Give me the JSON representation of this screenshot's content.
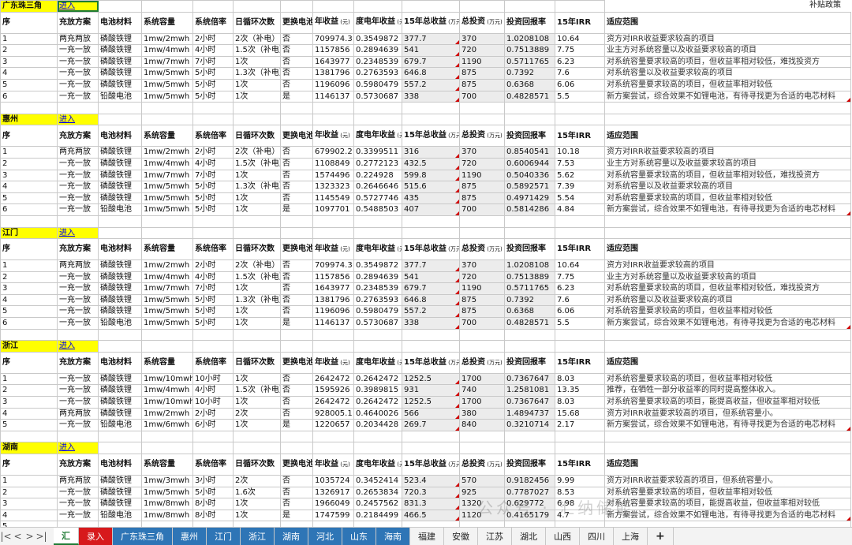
{
  "corner_note": "补贴政策",
  "watermark": "公众号 · 汇纳储能",
  "headers": [
    "序",
    "充放方案",
    "电池材料",
    "系统容量",
    "系统倍率",
    "日循环次数",
    "更换电池",
    "年收益",
    "度电年收益",
    "15年总收益",
    "总投资",
    "投资回报率",
    "15年IRR",
    "适应范围"
  ],
  "header_units": {
    "7": "(元)",
    "8": "(元)",
    "9": "(万元)",
    "10": "(万元)"
  },
  "regions": [
    {
      "name": "广东珠三角",
      "link": "进入",
      "rows": [
        [
          "1",
          "两充两放",
          "磷酸铁锂",
          "1mw/2mwh",
          "2小时",
          "2次（补电）",
          "否",
          "709974.3",
          "0.3549872",
          "377.7",
          "370",
          "1.0208108",
          "10.64",
          "资方对IRR收益要求较高的项目"
        ],
        [
          "2",
          "一充一放",
          "磷酸铁锂",
          "1mw/4mwh",
          "4小时",
          "1.5次（补电）",
          "否",
          "1157856",
          "0.2894639",
          "541",
          "720",
          "0.7513889",
          "7.75",
          "业主方对系统容量以及收益要求较高的项目"
        ],
        [
          "3",
          "一充一放",
          "磷酸铁锂",
          "1mw/7mwh",
          "7小时",
          "1次",
          "否",
          "1643977",
          "0.2348539",
          "679.7",
          "1190",
          "0.5711765",
          "6.23",
          "对系统容量要求较高的项目，但收益率相对较低，难找投资方"
        ],
        [
          "4",
          "一充一放",
          "磷酸铁锂",
          "1mw/5mwh",
          "5小时",
          "1.3次（补电）",
          "否",
          "1381796",
          "0.2763593",
          "646.8",
          "875",
          "0.7392",
          "7.6",
          "对系统容量以及收益要求较高的项目"
        ],
        [
          "5",
          "一充一放",
          "磷酸铁锂",
          "1mw/5mwh",
          "5小时",
          "1次",
          "否",
          "1196096",
          "0.5980479",
          "557.2",
          "875",
          "0.6368",
          "6.06",
          "对系统容量要求较高的项目，但收益率相对较低"
        ],
        [
          "6",
          "一充一放",
          "铅酸电池",
          "1mw/5mwh",
          "5小时",
          "1次",
          "是",
          "1146137",
          "0.5730687",
          "338",
          "700",
          "0.4828571",
          "5.5",
          "新方案尝试，综合效果不如锂电池，有待寻找更为合适的电芯材料"
        ]
      ]
    },
    {
      "name": "惠州",
      "link": "进入",
      "rows": [
        [
          "1",
          "两充两放",
          "磷酸铁锂",
          "1mw/2mwh",
          "2小时",
          "2次（补电）",
          "否",
          "679902.2",
          "0.3399511",
          "316",
          "370",
          "0.8540541",
          "10.18",
          "资方对IRR收益要求较高的项目"
        ],
        [
          "2",
          "一充一放",
          "磷酸铁锂",
          "1mw/4mwh",
          "4小时",
          "1.5次（补电）",
          "否",
          "1108849",
          "0.2772123",
          "432.5",
          "720",
          "0.6006944",
          "7.53",
          "业主方对系统容量以及收益要求较高的项目"
        ],
        [
          "3",
          "一充一放",
          "磷酸铁锂",
          "1mw/7mwh",
          "7小时",
          "1次",
          "否",
          "1574496",
          "0.224928",
          "599.8",
          "1190",
          "0.5040336",
          "5.62",
          "对系统容量要求较高的项目，但收益率相对较低，难找投资方"
        ],
        [
          "4",
          "一充一放",
          "磷酸铁锂",
          "1mw/5mwh",
          "5小时",
          "1.3次（补电）",
          "否",
          "1323323",
          "0.2646646",
          "515.6",
          "875",
          "0.5892571",
          "7.39",
          "对系统容量以及收益要求较高的项目"
        ],
        [
          "5",
          "一充一放",
          "磷酸铁锂",
          "1mw/5mwh",
          "5小时",
          "1次",
          "否",
          "1145549",
          "0.5727746",
          "435",
          "875",
          "0.4971429",
          "5.54",
          "对系统容量要求较高的项目，但收益率相对较低"
        ],
        [
          "6",
          "一充一放",
          "铅酸电池",
          "1mw/5mwh",
          "5小时",
          "1次",
          "是",
          "1097701",
          "0.5488503",
          "407",
          "700",
          "0.5814286",
          "4.84",
          "新方案尝试，综合效果不如锂电池，有待寻找更为合适的电芯材料"
        ]
      ]
    },
    {
      "name": "江门",
      "link": "进入",
      "rows": [
        [
          "1",
          "两充两放",
          "磷酸铁锂",
          "1mw/2mwh",
          "2小时",
          "2次（补电）",
          "否",
          "709974.3",
          "0.3549872",
          "377.7",
          "370",
          "1.0208108",
          "10.64",
          "资方对IRR收益要求较高的项目"
        ],
        [
          "2",
          "一充一放",
          "磷酸铁锂",
          "1mw/4mwh",
          "4小时",
          "1.5次（补电）",
          "否",
          "1157856",
          "0.2894639",
          "541",
          "720",
          "0.7513889",
          "7.75",
          "业主方对系统容量以及收益要求较高的项目"
        ],
        [
          "3",
          "一充一放",
          "磷酸铁锂",
          "1mw/7mwh",
          "7小时",
          "1次",
          "否",
          "1643977",
          "0.2348539",
          "679.7",
          "1190",
          "0.5711765",
          "6.23",
          "对系统容量要求较高的项目，但收益率相对较低，难找投资方"
        ],
        [
          "4",
          "一充一放",
          "磷酸铁锂",
          "1mw/5mwh",
          "5小时",
          "1.3次（补电）",
          "否",
          "1381796",
          "0.2763593",
          "646.8",
          "875",
          "0.7392",
          "7.6",
          "对系统容量以及收益要求较高的项目"
        ],
        [
          "5",
          "一充一放",
          "磷酸铁锂",
          "1mw/5mwh",
          "5小时",
          "1次",
          "否",
          "1196096",
          "0.5980479",
          "557.2",
          "875",
          "0.6368",
          "6.06",
          "对系统容量要求较高的项目，但收益率相对较低"
        ],
        [
          "6",
          "一充一放",
          "铅酸电池",
          "1mw/5mwh",
          "5小时",
          "1次",
          "是",
          "1146137",
          "0.5730687",
          "338",
          "700",
          "0.4828571",
          "5.5",
          "新方案尝试，综合效果不如锂电池，有待寻找更为合适的电芯材料"
        ]
      ]
    },
    {
      "name": "浙江",
      "link": "进入",
      "rows": [
        [
          "1",
          "一充一放",
          "磷酸铁锂",
          "1mw/10mwh",
          "10小时",
          "1次",
          "否",
          "2642472",
          "0.2642472",
          "1252.5",
          "1700",
          "0.7367647",
          "8.03",
          "对系统容量要求较高的项目，但收益率相对较低"
        ],
        [
          "2",
          "一充一放",
          "磷酸铁锂",
          "1mw/4mwh",
          "4小时",
          "1.5次（补电）",
          "否",
          "1595926",
          "0.3989815",
          "931",
          "740",
          "1.2581081",
          "13.35",
          "推荐，在牺牲一部分收益率的同时提高整体收入。"
        ],
        [
          "3",
          "一充一放",
          "磷酸铁锂",
          "1mw/10mwh",
          "10小时",
          "1次",
          "否",
          "2642472",
          "0.2642472",
          "1252.5",
          "1700",
          "0.7367647",
          "8.03",
          "对系统容量要求较高的项目，能提高收益，但收益率相对较低"
        ],
        [
          "4",
          "两充两放",
          "磷酸铁锂",
          "1mw/2mwh",
          "2小时",
          "2次",
          "否",
          "928005.1",
          "0.4640026",
          "566",
          "380",
          "1.4894737",
          "15.68",
          "资方对IRR收益要求较高的项目，但系统容量小。"
        ],
        [
          "5",
          "一充一放",
          "铅酸电池",
          "1mw/6mwh",
          "6小时",
          "1次",
          "是",
          "1220657",
          "0.2034428",
          "269.7",
          "840",
          "0.3210714",
          "2.17",
          "新方案尝试，综合效果不如锂电池，有待寻找更为合适的电芯材料"
        ]
      ]
    },
    {
      "name": "湖南",
      "link": "进入",
      "rows": [
        [
          "1",
          "两充两放",
          "磷酸铁锂",
          "1mw/3mwh",
          "3小时",
          "2次",
          "否",
          "1035724",
          "0.3452414",
          "523.4",
          "570",
          "0.9182456",
          "9.99",
          "资方对IRR收益要求较高的项目，但系统容量小。"
        ],
        [
          "2",
          "一充一放",
          "磷酸铁锂",
          "1mw/5mwh",
          "5小时",
          "1.6次",
          "否",
          "1326917",
          "0.2653834",
          "720.3",
          "925",
          "0.7787027",
          "8.53",
          "对系统容量要求较高的项目，但收益率相对较低"
        ],
        [
          "3",
          "一充一放",
          "磷酸铁锂",
          "1mw/8mwh",
          "8小时",
          "1次",
          "否",
          "1966049",
          "0.2457562",
          "831.3",
          "1320",
          "0.629772",
          "6.98",
          "对系统容量要求较高的项目，能提高收益，但收益率相对较低"
        ],
        [
          "4",
          "一充一放",
          "铅酸电池",
          "1mw/8mwh",
          "8小时",
          "1次",
          "是",
          "1747599",
          "0.2184499",
          "466.5",
          "1120",
          "0.4165179",
          "4.7",
          "新方案尝试，综合效果不如锂电池，有待寻找更为合适的电芯材料"
        ],
        [
          "5",
          "",
          "",
          "",
          "",
          "",
          "",
          "",
          "",
          "",
          "",
          "",
          "",
          ""
        ]
      ]
    }
  ],
  "tabs": [
    {
      "label": "汇",
      "style": "active"
    },
    {
      "label": "录入",
      "style": "red"
    },
    {
      "label": "广东珠三角",
      "style": "blue"
    },
    {
      "label": "惠州",
      "style": "blue"
    },
    {
      "label": "江门",
      "style": "blue"
    },
    {
      "label": "浙江",
      "style": "blue"
    },
    {
      "label": "湖南",
      "style": "blue"
    },
    {
      "label": "河北",
      "style": "blue"
    },
    {
      "label": "山东",
      "style": "blue"
    },
    {
      "label": "海南",
      "style": "blue"
    },
    {
      "label": "福建",
      "style": ""
    },
    {
      "label": "安徽",
      "style": ""
    },
    {
      "label": "江苏",
      "style": ""
    },
    {
      "label": "湖北",
      "style": ""
    },
    {
      "label": "山西",
      "style": ""
    },
    {
      "label": "四川",
      "style": ""
    },
    {
      "label": "上海",
      "style": ""
    }
  ],
  "nav": {
    "first": "|<",
    "prev": "<",
    "next": ">",
    "last": ">|",
    "add": "+"
  }
}
